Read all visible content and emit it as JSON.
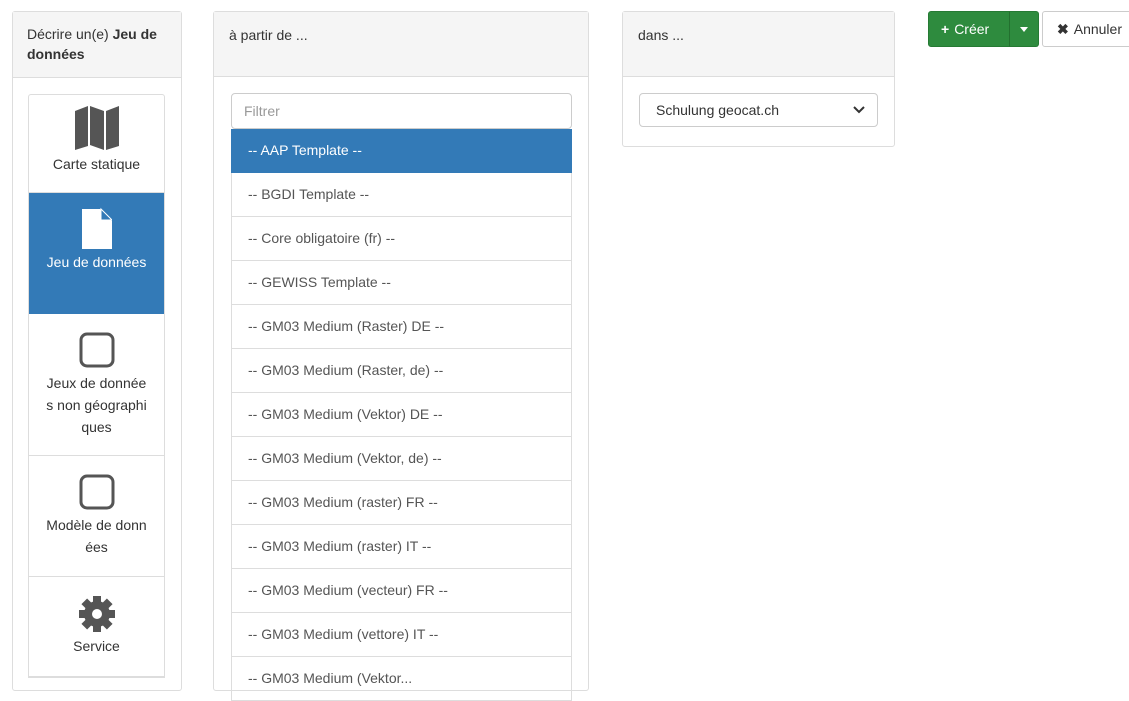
{
  "type_panel": {
    "heading_prefix": "Décrire un(e) ",
    "heading_bold": "Jeu de données",
    "items": [
      {
        "label": "Carte statique",
        "icon": "map-icon"
      },
      {
        "label": "Jeu de données",
        "icon": "file-icon"
      },
      {
        "label": "Jeux de données non géographiques",
        "icon": "square-icon"
      },
      {
        "label": "Modèle de données",
        "icon": "square-icon"
      },
      {
        "label": "Service",
        "icon": "gear-icon"
      }
    ],
    "active_index": 1
  },
  "template_panel": {
    "heading": "à partir de ...",
    "filter_placeholder": "Filtrer",
    "templates": [
      "-- AAP Template --",
      "-- BGDI Template --",
      "-- Core obligatoire (fr) --",
      "-- GEWISS Template --",
      "-- GM03 Medium (Raster) DE --",
      "-- GM03 Medium (Raster, de) --",
      "-- GM03 Medium (Vektor) DE --",
      "-- GM03 Medium (Vektor, de) --",
      "-- GM03 Medium (raster) FR --",
      "-- GM03 Medium (raster) IT --",
      "-- GM03 Medium (vecteur) FR --",
      "-- GM03 Medium (vettore) IT --",
      "-- GM03 Medium (Vektor..."
    ],
    "active_index": 0
  },
  "group_panel": {
    "heading": "dans ...",
    "selected_group": "Schulung geocat.ch"
  },
  "actions": {
    "create_icon": "+",
    "create_label": "Créer",
    "cancel_icon": "✖",
    "cancel_label": "Annuler"
  },
  "colors": {
    "primary": "#337ab7",
    "success": "#2e8b3e",
    "border": "#dddddd"
  }
}
